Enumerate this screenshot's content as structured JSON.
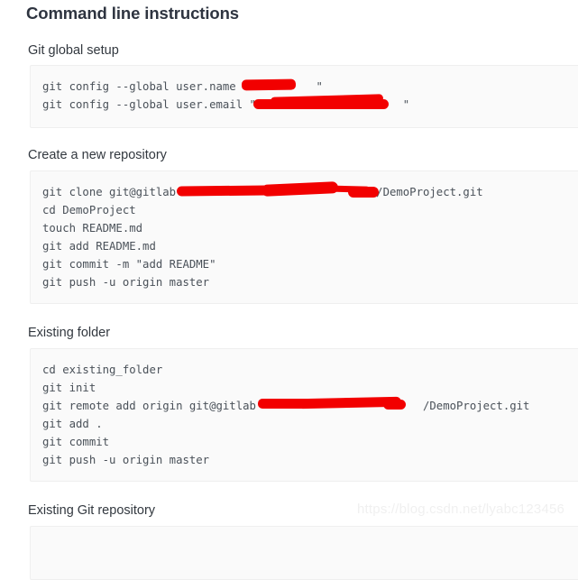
{
  "page": {
    "title": "Command line instructions"
  },
  "watermark": {
    "text": "https://blog.csdn.net/lyabc123456"
  },
  "sections": [
    {
      "id": "git-global-setup",
      "title": "Git global setup",
      "lines": [
        "git config --global user.name \"          \"",
        "git config --global user.email \"                      \""
      ]
    },
    {
      "id": "create-a-new-repository",
      "title": "Create a new repository",
      "lines": [
        "git clone git@gitlab                              /DemoProject.git",
        "cd DemoProject",
        "touch README.md",
        "git add README.md",
        "git commit -m \"add README\"",
        "git push -u origin master"
      ]
    },
    {
      "id": "existing-folder",
      "title": "Existing folder",
      "lines": [
        "cd existing_folder",
        "git init",
        "git remote add origin git@gitlab                         /DemoProject.git",
        "git add .",
        "git commit",
        "git push -u origin master"
      ]
    },
    {
      "id": "existing-git-repository",
      "title": "Existing Git repository",
      "lines": []
    }
  ],
  "colors": {
    "redaction": "#f20000",
    "code_background": "#fafafa",
    "code_text": "#4a5159",
    "heading": "#2e3440",
    "watermark": "#f0f0f0"
  }
}
